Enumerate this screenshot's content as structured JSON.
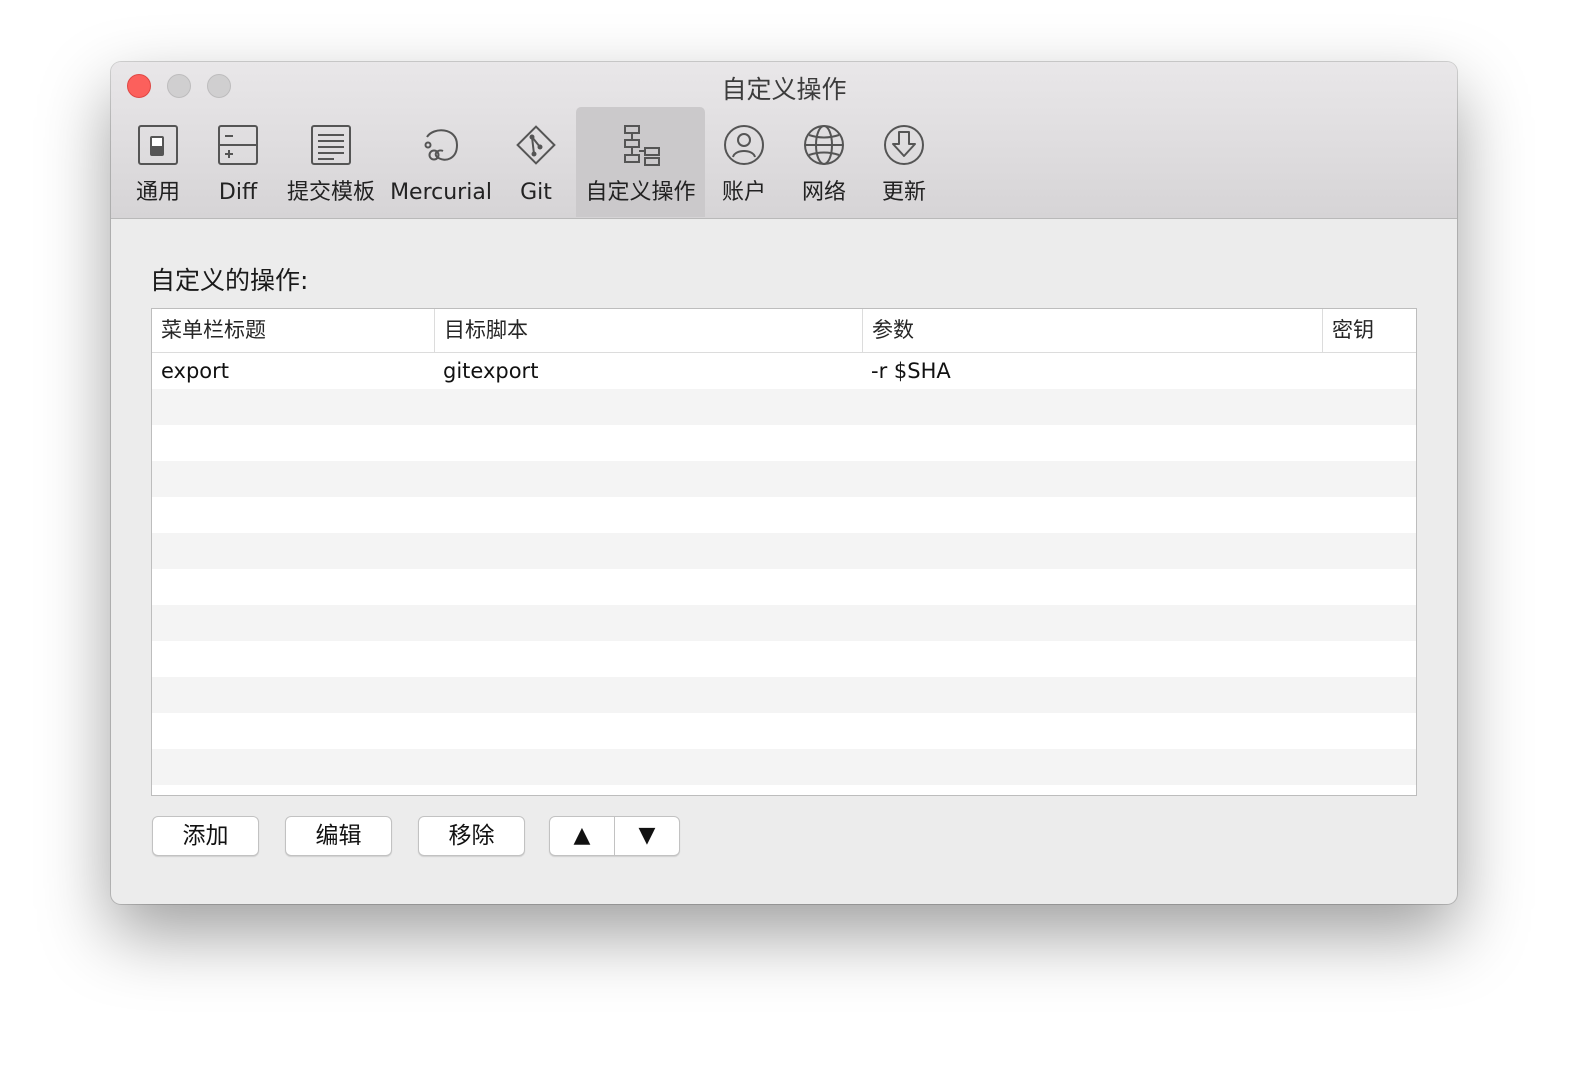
{
  "window": {
    "title": "自定义操作"
  },
  "toolbar": {
    "items": [
      {
        "label": "通用",
        "icon": "general-switch-icon"
      },
      {
        "label": "Diff",
        "icon": "diff-icon"
      },
      {
        "label": "提交模板",
        "icon": "commit-template-icon"
      },
      {
        "label": "Mercurial",
        "icon": "mercurial-icon"
      },
      {
        "label": "Git",
        "icon": "git-icon"
      },
      {
        "label": "自定义操作",
        "icon": "custom-actions-icon",
        "selected": true
      },
      {
        "label": "账户",
        "icon": "account-icon"
      },
      {
        "label": "网络",
        "icon": "network-globe-icon"
      },
      {
        "label": "更新",
        "icon": "update-download-icon"
      }
    ]
  },
  "main": {
    "section_label": "自定义的操作:",
    "table": {
      "columns": [
        "菜单栏标题",
        "目标脚本",
        "参数",
        "密钥"
      ],
      "rows": [
        {
          "menu_title": "export",
          "script": "gitexport",
          "params": "-r $SHA",
          "key": ""
        }
      ]
    },
    "buttons": {
      "add": "添加",
      "edit": "编辑",
      "remove": "移除",
      "move_up": "▲",
      "move_down": "▼"
    }
  }
}
